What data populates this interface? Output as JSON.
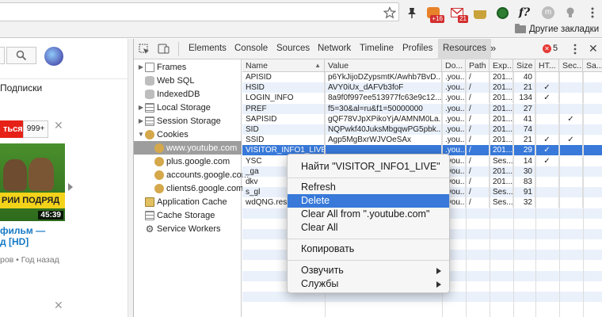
{
  "chrome": {
    "bookmarks_folder": "Другие закладки",
    "ext_badge_1": "+16",
    "ext_badge_2": "21",
    "ext_f": "f?",
    "ext_m": "m"
  },
  "youtube": {
    "subscriptions": "Подписки",
    "subscribe_btn": "ться",
    "sub_count": "999+",
    "thumb_text": "РИИ ПОДРЯД",
    "duration": "45:39",
    "title_line1": "фильм —",
    "title_line2": "д [HD]",
    "meta": "ров • Год назад"
  },
  "devtools": {
    "tabs": [
      "Elements",
      "Console",
      "Sources",
      "Network",
      "Timeline",
      "Profiles",
      "Resources"
    ],
    "more": "»",
    "error_count": "5",
    "sidebar": [
      {
        "label": "Frames"
      },
      {
        "label": "Web SQL"
      },
      {
        "label": "IndexedDB"
      },
      {
        "label": "Local Storage"
      },
      {
        "label": "Session Storage"
      },
      {
        "label": "Cookies"
      },
      {
        "label": "www.youtube.com"
      },
      {
        "label": "plus.google.com"
      },
      {
        "label": "accounts.google.com"
      },
      {
        "label": "clients6.google.com"
      },
      {
        "label": "Application Cache"
      },
      {
        "label": "Cache Storage"
      },
      {
        "label": "Service Workers"
      }
    ],
    "columns": [
      "Name",
      "Value",
      "Do...",
      "Path",
      "Exp...",
      "Size",
      "HT...",
      "Sec...",
      "Sa..."
    ],
    "rows": [
      {
        "name": "APISID",
        "value": "p6YkJijoDZypsmtK/Awhb7BvD...",
        "domain": ".you...",
        "path": "/",
        "exp": "201...",
        "size": "40",
        "http": "",
        "sec": ""
      },
      {
        "name": "HSID",
        "value": "AVY0iUx_dAFVb3foF",
        "domain": ".you...",
        "path": "/",
        "exp": "201...",
        "size": "21",
        "http": "✓",
        "sec": ""
      },
      {
        "name": "LOGIN_INFO",
        "value": "8a9f0f997ee513977fc63e9c12...",
        "domain": ".you...",
        "path": "/",
        "exp": "201...",
        "size": "134",
        "http": "✓",
        "sec": ""
      },
      {
        "name": "PREF",
        "value": "f5=30&al=ru&f1=50000000",
        "domain": ".you...",
        "path": "/",
        "exp": "201...",
        "size": "27",
        "http": "",
        "sec": ""
      },
      {
        "name": "SAPISID",
        "value": "gQF78VJpXPikoYjA/AMNM0La...",
        "domain": ".you...",
        "path": "/",
        "exp": "201...",
        "size": "41",
        "http": "",
        "sec": "✓"
      },
      {
        "name": "SID",
        "value": "NQPwkf40JuksMbgqwPG5pbk...",
        "domain": ".you...",
        "path": "/",
        "exp": "201...",
        "size": "74",
        "http": "",
        "sec": ""
      },
      {
        "name": "SSID",
        "value": "Agp5MgBxrWJVOeSAx",
        "domain": ".you...",
        "path": "/",
        "exp": "201...",
        "size": "21",
        "http": "✓",
        "sec": "✓"
      },
      {
        "name": "VISITOR_INFO1_LIVE",
        "value": "",
        "domain": ".you...",
        "path": "/",
        "exp": "201...",
        "size": "29",
        "http": "✓",
        "sec": ""
      },
      {
        "name": "YSC",
        "value": "",
        "domain": ".you...",
        "path": "/",
        "exp": "Ses...",
        "size": "14",
        "http": "✓",
        "sec": ""
      },
      {
        "name": "_ga",
        "value": "",
        "domain": ".you...",
        "path": "/",
        "exp": "201...",
        "size": "30",
        "http": "",
        "sec": ""
      },
      {
        "name": "dkv",
        "value": "",
        "domain": ".you...",
        "path": "/",
        "exp": "201...",
        "size": "83",
        "http": "",
        "sec": ""
      },
      {
        "name": "s_gl",
        "value": "",
        "domain": ".you...",
        "path": "/",
        "exp": "Ses...",
        "size": "91",
        "http": "",
        "sec": ""
      },
      {
        "name": "wdQNG.resu",
        "value": "",
        "domain": ".you...",
        "path": "/",
        "exp": "Ses...",
        "size": "32",
        "http": "",
        "sec": ""
      }
    ]
  },
  "context_menu": {
    "find": "Найти \"VISITOR_INFO1_LIVE\"",
    "refresh": "Refresh",
    "delete": "Delete",
    "clear_from": "Clear All from \".youtube.com\"",
    "clear_all": "Clear All",
    "copy": "Копировать",
    "speak": "Озвучить",
    "services": "Службы"
  }
}
